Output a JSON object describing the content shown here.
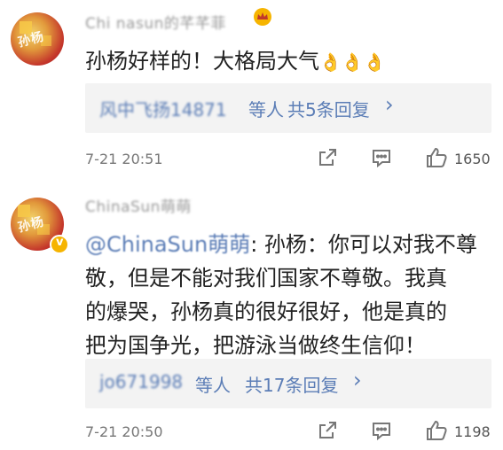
{
  "comments": [
    {
      "username": "Chi nasun的芊芊菲",
      "username_icon": "crown-badge-icon",
      "text": "孙杨好样的！大格局大气",
      "emoji": "👌👌👌",
      "emoji_icon": "ok-hand-icon",
      "reply_names": "风中飞扬14871",
      "reply_etc": "等人",
      "reply_total": "共5条回复",
      "reply_chevron": "›",
      "time": "7-21 20:51",
      "like_count": "1650"
    },
    {
      "username": "ChinaSun萌萌",
      "verified_icon": "verified-badge-icon",
      "mention": "@ChinaSun萌萌",
      "text_after_mention": ": 孙杨：你可以对我不尊",
      "text_lines": [
        "敬，但是不能对我们国家不尊敬。我真",
        "的爆哭，孙杨真的很好很好，他是真的",
        "把为国争光，把游泳当做终生信仰！"
      ],
      "reply_names": "jo671998",
      "reply_etc": "等人",
      "reply_total": "共17条回复",
      "reply_chevron": "›",
      "time": "7-21 20:50",
      "like_count": "1198"
    }
  ],
  "actions": {
    "share_icon": "share-icon",
    "comment_icon": "comment-icon",
    "like_icon": "like-thumb-icon"
  },
  "colors": {
    "link": "#5b7db6",
    "reply_bg": "#f3f3f3",
    "text": "#222222",
    "meta": "#777777"
  }
}
